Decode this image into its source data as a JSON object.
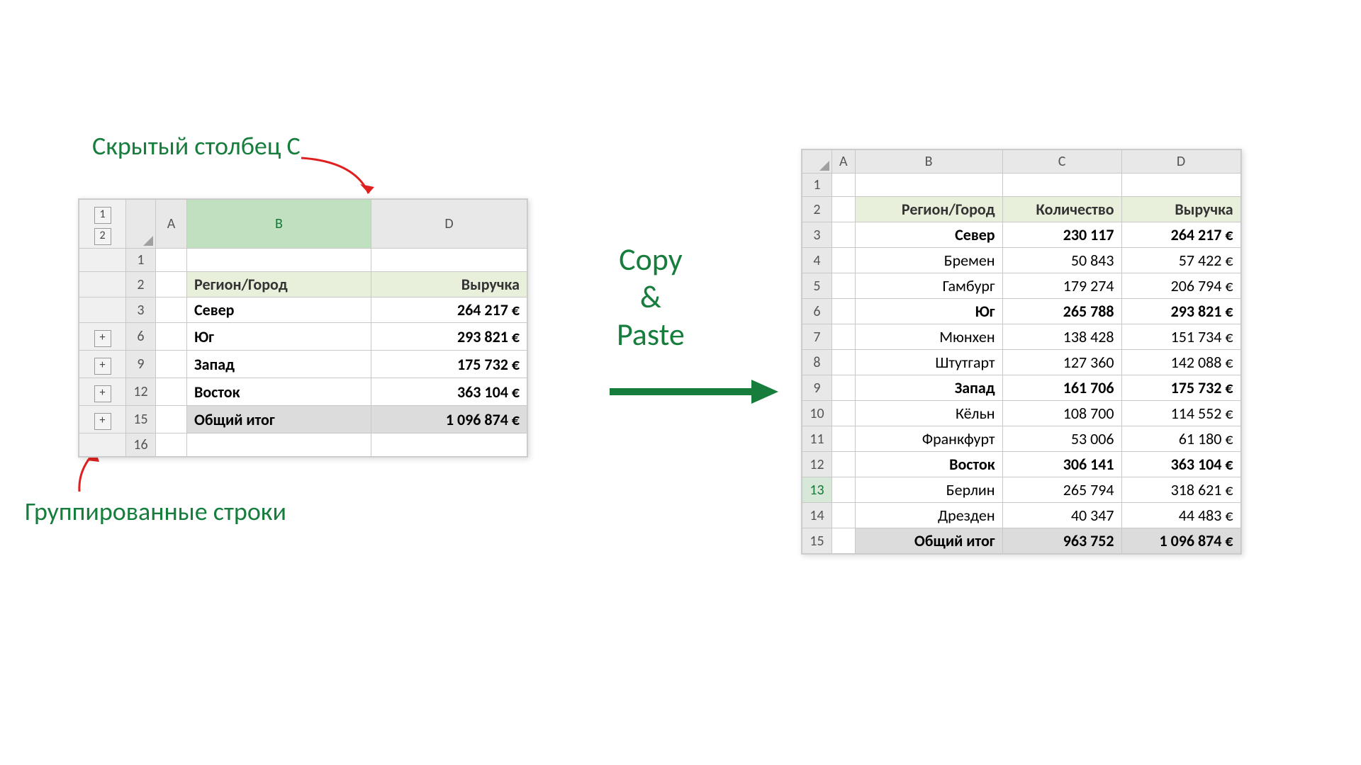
{
  "annotations": {
    "hiddenCol": "Скрытый столбец С",
    "groupedRows": "Группированные строки",
    "copyPaste1": "Copy",
    "copyPaste2": "&",
    "copyPaste3": "Paste"
  },
  "outline": {
    "level1": "1",
    "level2": "2",
    "expand": "+"
  },
  "left": {
    "col_A": "A",
    "col_B": "B",
    "col_D": "D",
    "rows": [
      "1",
      "2",
      "3",
      "6",
      "9",
      "12",
      "15",
      "16"
    ],
    "hdr_region": "Регион/Город",
    "hdr_rev": "Выручка",
    "r_sever": "Север",
    "v_sever": "264 217 €",
    "r_yug": "Юг",
    "v_yug": "293 821 €",
    "r_zapad": "Запад",
    "v_zapad": "175 732 €",
    "r_vostok": "Восток",
    "v_vostok": "363 104 €",
    "r_total": "Общий итог",
    "v_total": "1 096 874 €"
  },
  "right": {
    "cols": [
      "A",
      "B",
      "C",
      "D"
    ],
    "rowNums": [
      "1",
      "2",
      "3",
      "4",
      "5",
      "6",
      "7",
      "8",
      "9",
      "10",
      "11",
      "12",
      "13",
      "14",
      "15"
    ],
    "hdr_region": "Регион/Город",
    "hdr_qty": "Количество",
    "hdr_rev": "Выручка",
    "data": [
      {
        "name": "Север",
        "qty": "230 117",
        "rev": "264 217 €",
        "bold": true
      },
      {
        "name": "Бремен",
        "qty": "50 843",
        "rev": "57 422 €",
        "indent": true
      },
      {
        "name": "Гамбург",
        "qty": "179 274",
        "rev": "206 794 €",
        "indent": true
      },
      {
        "name": "Юг",
        "qty": "265 788",
        "rev": "293 821 €",
        "bold": true
      },
      {
        "name": "Мюнхен",
        "qty": "138 428",
        "rev": "151 734 €",
        "indent": true
      },
      {
        "name": "Штутгарт",
        "qty": "127 360",
        "rev": "142 088 €",
        "indent": true
      },
      {
        "name": "Запад",
        "qty": "161 706",
        "rev": "175 732 €",
        "bold": true
      },
      {
        "name": "Кёльн",
        "qty": "108 700",
        "rev": "114 552 €",
        "indent": true
      },
      {
        "name": "Франкфурт",
        "qty": "53 006",
        "rev": "61 180 €",
        "indent": true
      },
      {
        "name": "Восток",
        "qty": "306 141",
        "rev": "363 104 €",
        "bold": true
      },
      {
        "name": "Берлин",
        "qty": "265 794",
        "rev": "318 621 €",
        "indent": true
      },
      {
        "name": "Дрезден",
        "qty": "40 347",
        "rev": "44 483 €",
        "indent": true
      }
    ],
    "total_name": "Общий итог",
    "total_qty": "963 752",
    "total_rev": "1 096 874 €"
  },
  "chart_data": {
    "type": "table",
    "title": "Регион/Город — Количество / Выручка",
    "columns": [
      "Регион/Город",
      "Количество",
      "Выручка"
    ],
    "rows": [
      [
        "Север",
        230117,
        264217
      ],
      [
        "Бремен",
        50843,
        57422
      ],
      [
        "Гамбург",
        179274,
        206794
      ],
      [
        "Юг",
        265788,
        293821
      ],
      [
        "Мюнхен",
        138428,
        151734
      ],
      [
        "Штутгарт",
        127360,
        142088
      ],
      [
        "Запад",
        161706,
        175732
      ],
      [
        "Кёльн",
        108700,
        114552
      ],
      [
        "Франкфурт",
        53006,
        61180
      ],
      [
        "Восток",
        306141,
        363104
      ],
      [
        "Берлин",
        265794,
        318621
      ],
      [
        "Дрезден",
        40347,
        44483
      ],
      [
        "Общий итог",
        963752,
        1096874
      ]
    ],
    "currency": "EUR",
    "left_summary": {
      "columns": [
        "Регион/Город",
        "Выручка"
      ],
      "rows": [
        [
          "Север",
          264217
        ],
        [
          "Юг",
          293821
        ],
        [
          "Запад",
          175732
        ],
        [
          "Восток",
          363104
        ],
        [
          "Общий итог",
          1096874
        ]
      ],
      "hidden_column": "C",
      "grouped_rows": true
    }
  }
}
